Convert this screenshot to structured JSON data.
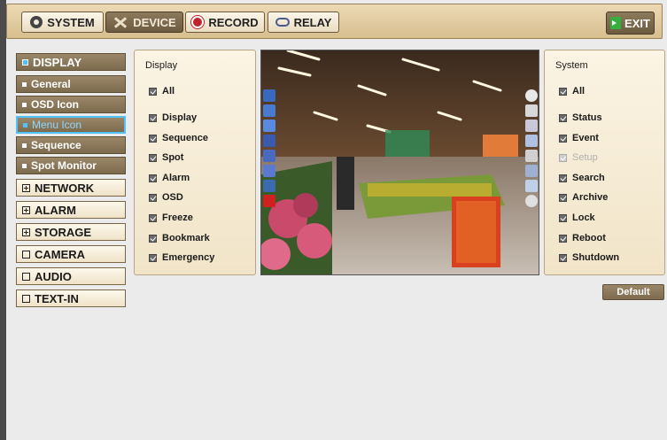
{
  "topbar": {
    "tabs": [
      {
        "label": "SYSTEM",
        "icon": "gear-icon"
      },
      {
        "label": "DEVICE",
        "icon": "tools-icon"
      },
      {
        "label": "RECORD",
        "icon": "record-icon"
      },
      {
        "label": "RELAY",
        "icon": "relay-icon"
      }
    ],
    "exit_label": "EXIT"
  },
  "sidebar": {
    "display_label": "DISPLAY",
    "sub_items": [
      "General",
      "OSD Icon",
      "Menu Icon",
      "Sequence",
      "Spot Monitor"
    ],
    "selected_sub": "Menu Icon",
    "groups": [
      "NETWORK",
      "ALARM",
      "STORAGE",
      "CAMERA",
      "AUDIO",
      "TEXT-IN"
    ]
  },
  "display_panel": {
    "title": "Display",
    "all_label": "All",
    "items": [
      "Display",
      "Sequence",
      "Spot",
      "Alarm",
      "OSD",
      "Freeze",
      "Bookmark",
      "Emergency"
    ]
  },
  "system_panel": {
    "title": "System",
    "all_label": "All",
    "items": [
      "Status",
      "Event",
      "Setup",
      "Search",
      "Archive",
      "Lock",
      "Reboot",
      "Shutdown"
    ],
    "disabled": [
      "Setup"
    ]
  },
  "default_label": "Default",
  "colors": {
    "accent_selected": "#4fc3f7",
    "button_brown": "#7d6b4e",
    "panel_cream": "#f8efdc",
    "record_red": "#c4222a",
    "exit_green": "#35b040"
  }
}
